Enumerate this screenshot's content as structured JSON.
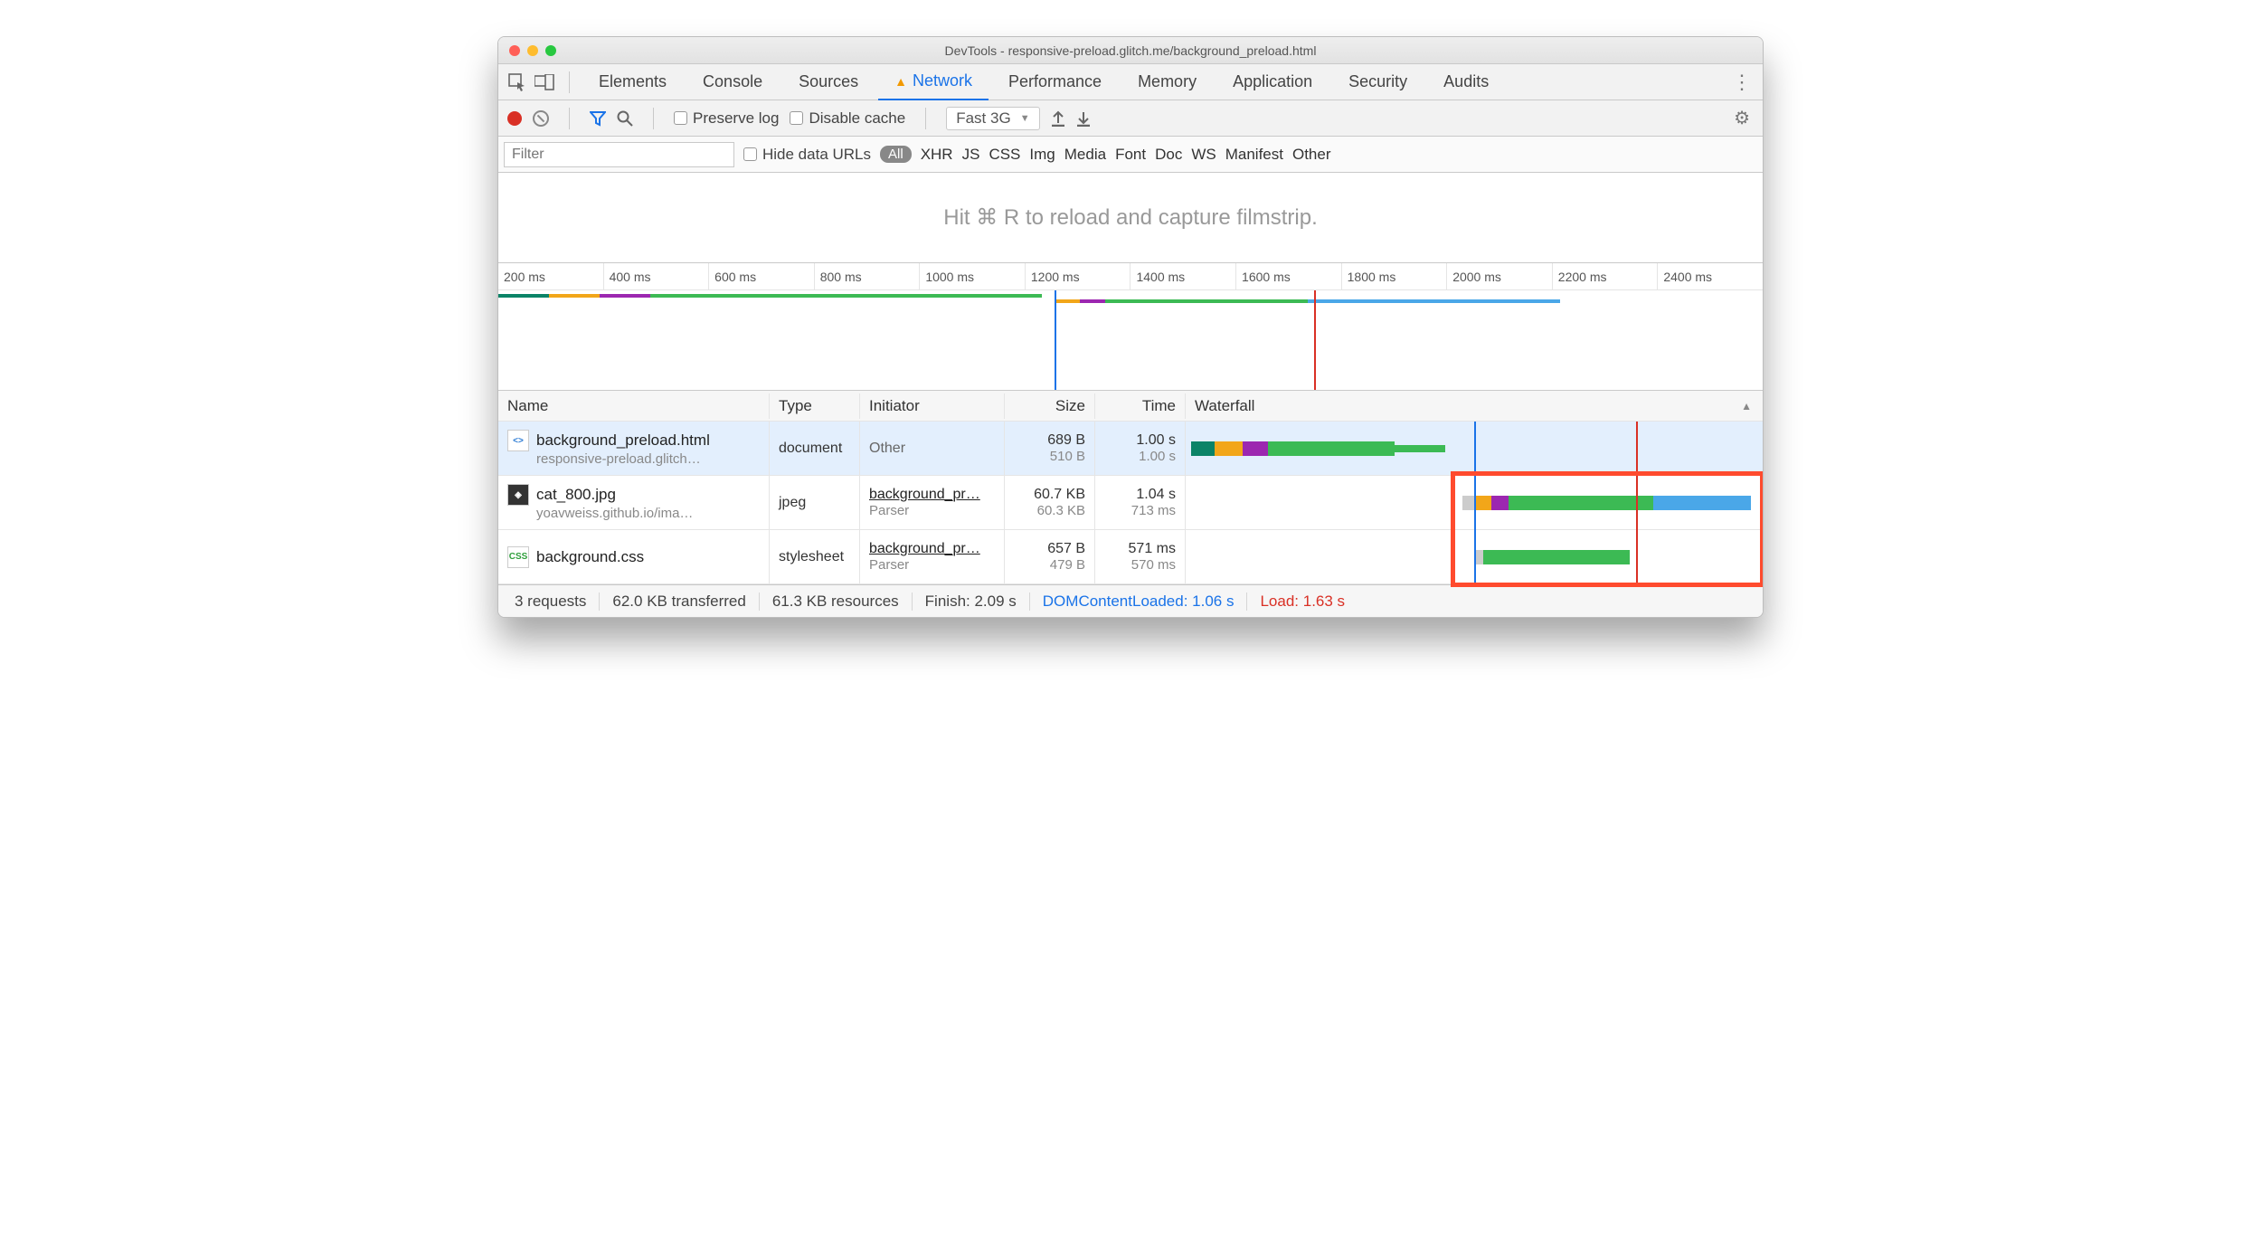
{
  "window_title": "DevTools - responsive-preload.glitch.me/background_preload.html",
  "tabs": [
    "Elements",
    "Console",
    "Sources",
    "Network",
    "Performance",
    "Memory",
    "Application",
    "Security",
    "Audits"
  ],
  "active_tab": "Network",
  "toolbar": {
    "preserve_log": "Preserve log",
    "disable_cache": "Disable cache",
    "throttle": "Fast 3G"
  },
  "filter": {
    "placeholder": "Filter",
    "hide_data_urls": "Hide data URLs",
    "types": [
      "All",
      "XHR",
      "JS",
      "CSS",
      "Img",
      "Media",
      "Font",
      "Doc",
      "WS",
      "Manifest",
      "Other"
    ],
    "selected_type": "All"
  },
  "hint": "Hit ⌘ R to reload and capture filmstrip.",
  "timeline_ticks": [
    "200 ms",
    "400 ms",
    "600 ms",
    "800 ms",
    "1000 ms",
    "1200 ms",
    "1400 ms",
    "1600 ms",
    "1800 ms",
    "2000 ms",
    "2200 ms",
    "2400 ms"
  ],
  "columns": [
    "Name",
    "Type",
    "Initiator",
    "Size",
    "Time",
    "Waterfall"
  ],
  "requests": [
    {
      "name": "background_preload.html",
      "name_sub": "responsive-preload.glitch…",
      "icon": "html",
      "type": "document",
      "initiator": "Other",
      "initiator_sub": "",
      "size": "689 B",
      "size_sub": "510 B",
      "time": "1.00 s",
      "time_sub": "1.00 s",
      "selected": true
    },
    {
      "name": "cat_800.jpg",
      "name_sub": "yoavweiss.github.io/ima…",
      "icon": "img",
      "type": "jpeg",
      "initiator": "background_pr…",
      "initiator_sub": "Parser",
      "size": "60.7 KB",
      "size_sub": "60.3 KB",
      "time": "1.04 s",
      "time_sub": "713 ms",
      "selected": false
    },
    {
      "name": "background.css",
      "name_sub": "",
      "icon": "css",
      "type": "stylesheet",
      "initiator": "background_pr…",
      "initiator_sub": "Parser",
      "size": "657 B",
      "size_sub": "479 B",
      "time": "571 ms",
      "time_sub": "570 ms",
      "selected": false
    }
  ],
  "status": {
    "requests": "3 requests",
    "transferred": "62.0 KB transferred",
    "resources": "61.3 KB resources",
    "finish": "Finish: 2.09 s",
    "dcl": "DOMContentLoaded: 1.06 s",
    "load": "Load: 1.63 s"
  }
}
